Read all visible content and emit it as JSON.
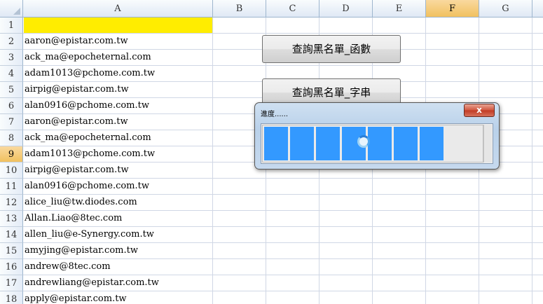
{
  "columns": [
    "A",
    "B",
    "C",
    "D",
    "E",
    "F",
    "G"
  ],
  "selected_column": "F",
  "selected_row": "9",
  "rows": [
    {
      "num": "1",
      "a": ""
    },
    {
      "num": "2",
      "a": "aaron@epistar.com.tw"
    },
    {
      "num": "3",
      "a": "ack_ma@epocheternal.com"
    },
    {
      "num": "4",
      "a": "adam1013@pchome.com.tw"
    },
    {
      "num": "5",
      "a": "airpig@epistar.com.tw"
    },
    {
      "num": "6",
      "a": "alan0916@pchome.com.tw"
    },
    {
      "num": "7",
      "a": "aaron@epistar.com.tw"
    },
    {
      "num": "8",
      "a": "ack_ma@epocheternal.com"
    },
    {
      "num": "9",
      "a": "adam1013@pchome.com.tw"
    },
    {
      "num": "10",
      "a": "airpig@epistar.com.tw"
    },
    {
      "num": "11",
      "a": "alan0916@pchome.com.tw"
    },
    {
      "num": "12",
      "a": "alice_liu@tw.diodes.com"
    },
    {
      "num": "13",
      "a": "Allan.Liao@8tec.com"
    },
    {
      "num": "14",
      "a": "allen_liu@e-Synergy.com.tw"
    },
    {
      "num": "15",
      "a": "amyjing@epistar.com.tw"
    },
    {
      "num": "16",
      "a": "andrew@8tec.com"
    },
    {
      "num": "17",
      "a": "andrewliang@epistar.com.tw"
    },
    {
      "num": "18",
      "a": "apply@epistar.com.tw"
    }
  ],
  "buttons": {
    "func_label": "查詢黑名單_函數",
    "string_label": "查詢黑名單_字串"
  },
  "progress_dialog": {
    "title": "進度......",
    "close_glyph": "x",
    "filled_segments": 7,
    "total_segments": 8,
    "percent": 87.5
  },
  "colors": {
    "highlight": "#ffed00",
    "progress": "#3399ff",
    "selected_header": "#f1c15f"
  }
}
